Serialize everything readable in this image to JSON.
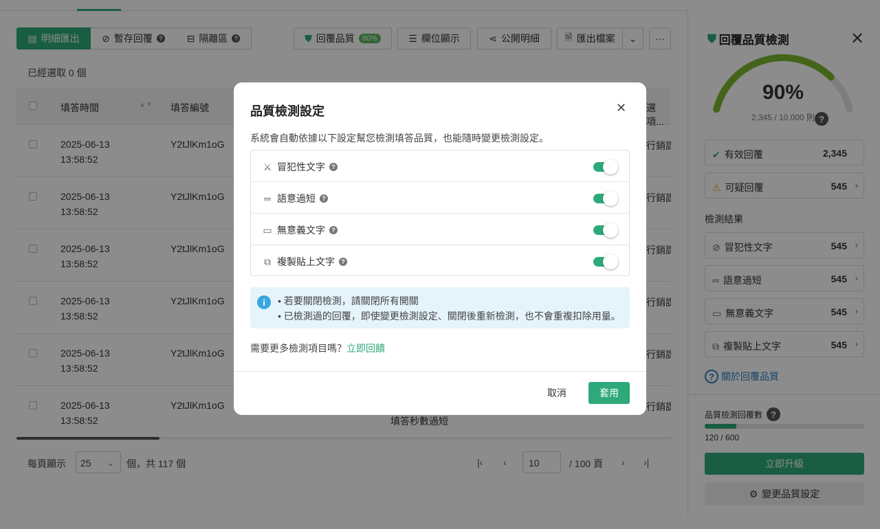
{
  "toolbar": {
    "export_detail": "明細匯出",
    "draft_responses": "暫存回覆",
    "quarantine": "隔離區",
    "quality": "回覆品質",
    "quality_pct": "80%",
    "column_display": "欄位顯示",
    "public_detail": "公開明細",
    "export_file": "匯出檔案",
    "more": "···"
  },
  "selected_text": "已經選取 0 個",
  "table": {
    "headers": {
      "time": "填答時間",
      "id": "填答編號",
      "options": "選項..."
    },
    "rows": [
      {
        "date": "2025-06-13",
        "time": "13:58:52",
        "id": "Y2tJlKm1oG",
        "tail": "行銷課"
      },
      {
        "date": "2025-06-13",
        "time": "13:58:52",
        "id": "Y2tJlKm1oG",
        "tail": "行銷課"
      },
      {
        "date": "2025-06-13",
        "time": "13:58:52",
        "id": "Y2tJlKm1oG",
        "tail": "行銷課"
      },
      {
        "date": "2025-06-13",
        "time": "13:58:52",
        "id": "Y2tJlKm1oG",
        "tail": "行銷課"
      },
      {
        "date": "2025-06-13",
        "time": "13:58:52",
        "id": "Y2tJlKm1oG",
        "tail": "行銷課"
      },
      {
        "date": "2025-06-13",
        "time": "13:58:52",
        "id": "Y2tJlKm1oG",
        "tail": "行銷課"
      }
    ],
    "row_note": "填答秒數過短"
  },
  "pager": {
    "per_page_label": "每頁顯示",
    "per_page_value": "25",
    "total_text": "個，共 117 個",
    "first": "|‹",
    "prev": "‹",
    "page_value": "10",
    "page_total": "/  100 頁",
    "next": "›",
    "last": "›|"
  },
  "panel": {
    "title": "回覆品質檢測",
    "close": "✕",
    "gauge_pct": "90%",
    "gauge_sub": "2,345 / 10,000 則",
    "gauge_fraction": 0.9,
    "valid_label": "有效回覆",
    "valid_value": "2,345",
    "suspect_label": "可疑回覆",
    "suspect_value": "545",
    "results_title": "檢測結果",
    "results": [
      {
        "icon": "⊘",
        "label": "冒犯性文字",
        "value": "545"
      },
      {
        "icon": "═",
        "label": "語意過短",
        "value": "545"
      },
      {
        "icon": "▭",
        "label": "無意義文字",
        "value": "545"
      },
      {
        "icon": "⧉",
        "label": "複製貼上文字",
        "value": "545"
      }
    ],
    "about_link": "關於回覆品質",
    "count_label": "品質檢測回覆數",
    "count_text": "120 / 600",
    "count_fraction": 0.2,
    "upgrade": "立即升級",
    "change_settings": "變更品質設定"
  },
  "modal": {
    "title": "品質檢測設定",
    "close": "✕",
    "description": "系統會自動依據以下設定幫您檢測填答品質，也能隨時變更檢測設定。",
    "options": [
      {
        "icon": "⚔",
        "label": "冒犯性文字",
        "enabled": true
      },
      {
        "icon": "═",
        "label": "語意過短",
        "enabled": true
      },
      {
        "icon": "▭",
        "label": "無意義文字",
        "enabled": true
      },
      {
        "icon": "⧉",
        "label": "複製貼上文字",
        "enabled": true
      }
    ],
    "tips": [
      "•  若要關閉檢測，請關閉所有開關",
      "•  已檢測過的回覆，即使變更檢測設定、關閉後重新檢測，也不會重複扣除用量。"
    ],
    "more_prefix": "需要更多檢測項目嗎？",
    "more_link": "立即回饋",
    "cancel": "取消",
    "apply": "套用"
  },
  "colors": {
    "accent": "#2ea97a",
    "info": "#3aa6e0",
    "warning": "#e8a317",
    "gauge": "#7cb82f"
  }
}
